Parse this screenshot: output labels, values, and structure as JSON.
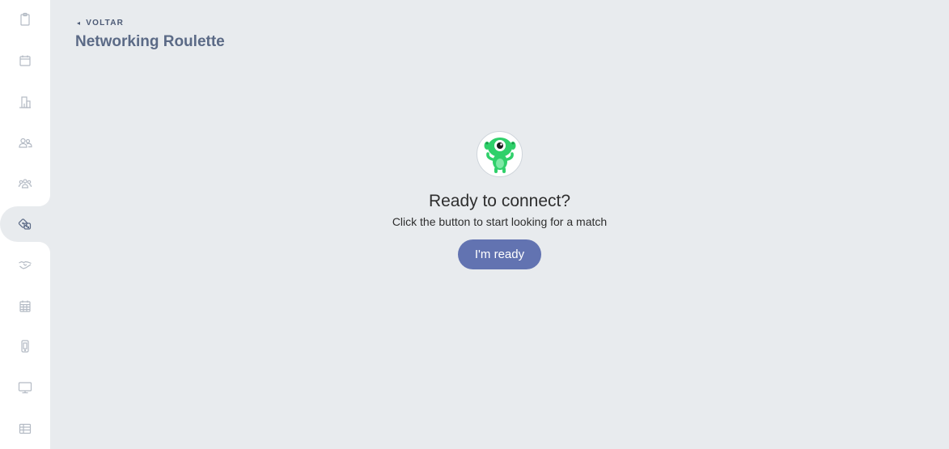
{
  "header": {
    "back_label": "VOLTAR",
    "title": "Networking Roulette"
  },
  "sidebar": {
    "items": [
      {
        "icon": "clipboard-icon"
      },
      {
        "icon": "calendar-icon"
      },
      {
        "icon": "building-icon"
      },
      {
        "icon": "people-icon"
      },
      {
        "icon": "group-icon"
      },
      {
        "icon": "dice-icon",
        "active": true
      },
      {
        "icon": "handshake-icon"
      },
      {
        "icon": "schedule-grid-icon"
      },
      {
        "icon": "mobile-icon"
      },
      {
        "icon": "monitor-icon"
      },
      {
        "icon": "table-icon"
      }
    ]
  },
  "main": {
    "avatar_icon": "monster-mascot",
    "headline": "Ready to connect?",
    "subline": "Click the button to start looking for a match",
    "button_label": "I'm ready"
  },
  "colors": {
    "background": "#e8ebee",
    "sidebar": "#ffffff",
    "accent": "#6273b1",
    "title": "#5b6a86",
    "icon": "#b3bac4",
    "mascot": "#2fd06a"
  }
}
